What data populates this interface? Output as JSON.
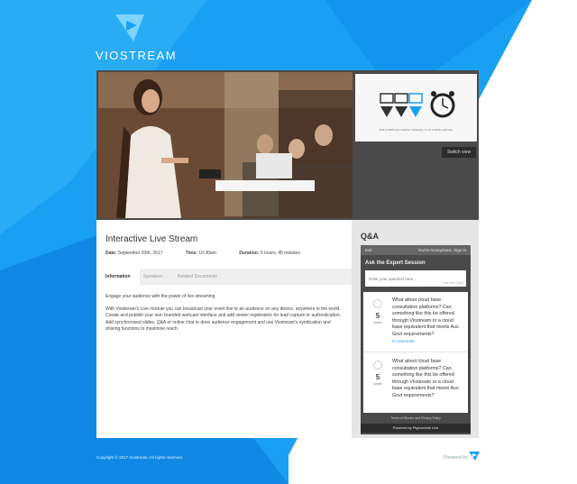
{
  "brand": {
    "name": "VIOSTREAM",
    "accent": "#1aa0f2"
  },
  "player": {
    "slide_caption": "51% of B2B uses webinar marketing / 3 out of white each day",
    "switch_view_label": "Switch view"
  },
  "event": {
    "title": "Interactive Live Stream",
    "date_label": "Date:",
    "date_value": "September 20th, 2017",
    "time_label": "Time:",
    "time_value": "10:30am",
    "duration_label": "Duration:",
    "duration_value": "6 hours, 45 minutes"
  },
  "tabs": [
    {
      "label": "Information",
      "active": true
    },
    {
      "label": "Speakers",
      "active": false
    },
    {
      "label": "Related Documents",
      "active": false
    }
  ],
  "description": {
    "intro": "Engage your audience with the power of live streaming.",
    "body": "With Viostream's Live module you can broadcast your event live to an audience on any device, anywhere in the world. Create and publish your own branded webcast interface and add viewer registration for lead capture or authentication. Add synchronised slides, Q&A or online chat to drive audience engagement and use Viostream's syndication and sharing functions to maximise reach."
  },
  "qa": {
    "title": "Q&A",
    "exit_label": "Exit",
    "user_label": "You're Anonymous. Sign in",
    "session_title": "Ask the Expert Session",
    "input_placeholder": "Enter your question here...",
    "input_button": "Ask the Q&A",
    "questions": [
      {
        "votes": "5",
        "votes_label": "votes",
        "text": "What about cloud base consultation platforms? Can something like this be offered through Viostream or a cloud base equivalent that meets Aus Govt requirements?",
        "comments": "0 comments"
      },
      {
        "votes": "5",
        "votes_label": "votes",
        "text": "What about cloud base consultation platforms? Can something like this be offered through Viostream or a cloud base equivalent that meets Aus Govt requirements?",
        "comments": ""
      }
    ],
    "terms": "Terms of Service and Privacy Policy",
    "powered": "Powered by Pigeonhole Live"
  },
  "footer": {
    "copyright": "Copyright © 2017 Viostream. All rights reserved.",
    "powered_by": "Powered by"
  }
}
